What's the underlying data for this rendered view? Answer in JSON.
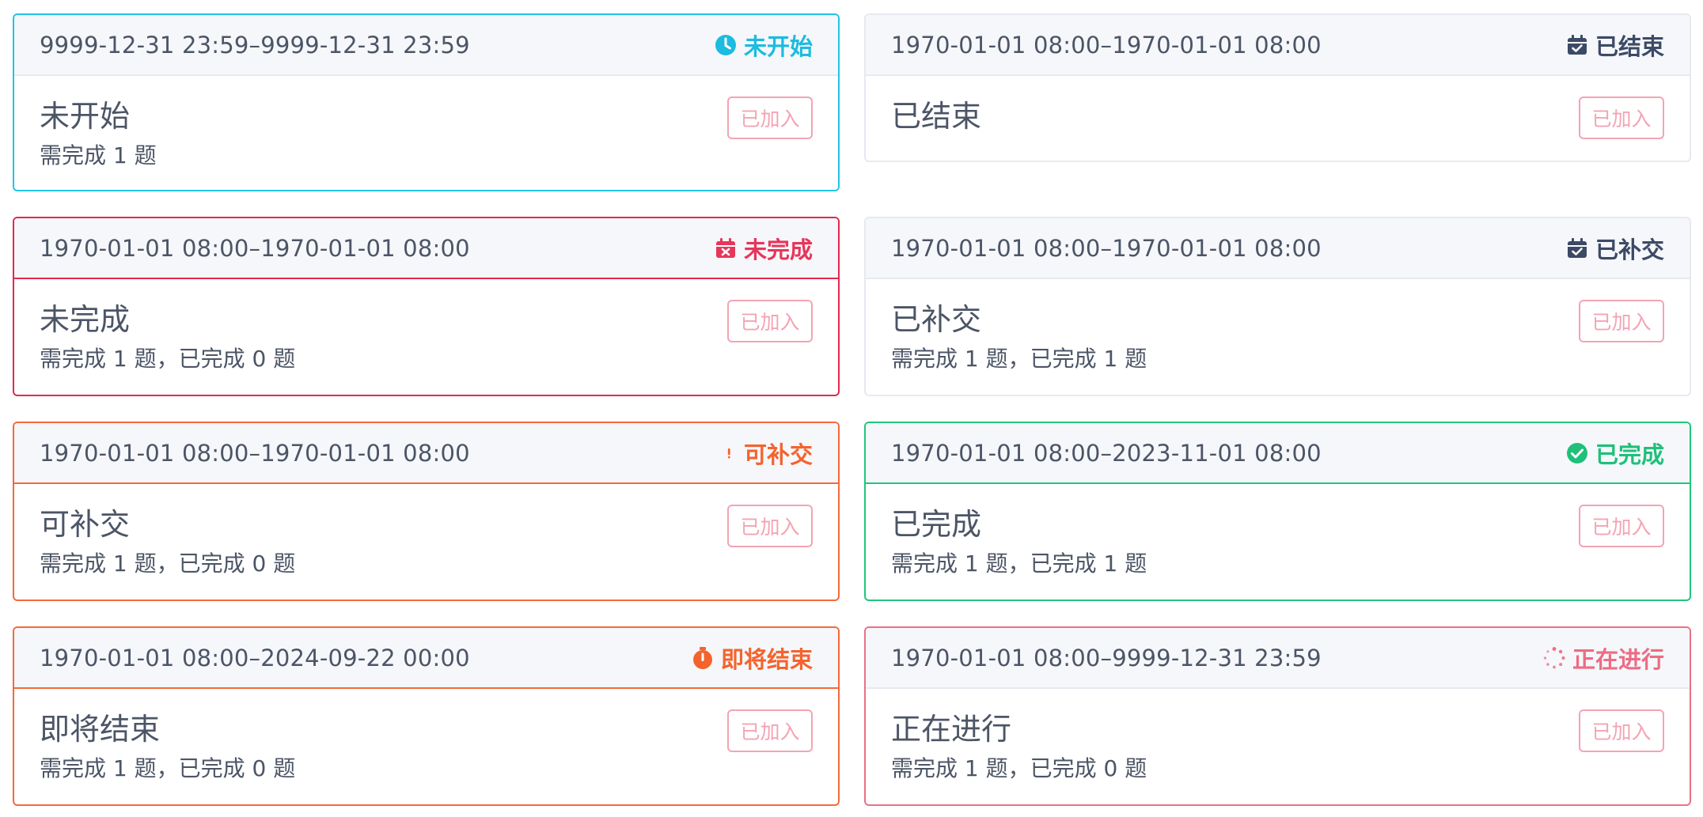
{
  "join_label": "已加入",
  "cards": [
    {
      "time": "9999-12-31 23:59–9999-12-31 23:59",
      "status": "未开始",
      "status_icon": "clock-icon",
      "title": "未开始",
      "desc": "需完成 1 题",
      "accent": "#1cbbe0"
    },
    {
      "time": "1970-01-01 08:00–1970-01-01 08:00",
      "status": "已结束",
      "status_icon": "calendar-check-icon",
      "title": "已结束",
      "desc": "",
      "accent": "#3c4a66"
    },
    {
      "time": "1970-01-01 08:00–1970-01-01 08:00",
      "status": "未完成",
      "status_icon": "calendar-x-icon",
      "title": "未完成",
      "desc": "需完成 1 题，已完成 0 题",
      "accent": "#e8355a"
    },
    {
      "time": "1970-01-01 08:00–1970-01-01 08:00",
      "status": "已补交",
      "status_icon": "calendar-check-icon",
      "title": "已补交",
      "desc": "需完成 1 题，已完成 1 题",
      "accent": "#3c4a66"
    },
    {
      "time": "1970-01-01 08:00–1970-01-01 08:00",
      "status": "可补交",
      "status_icon": "exclamation-icon",
      "title": "可补交",
      "desc": "需完成 1 题，已完成 0 题",
      "accent": "#f5632d"
    },
    {
      "time": "1970-01-01 08:00–2023-11-01 08:00",
      "status": "已完成",
      "status_icon": "check-circle-icon",
      "title": "已完成",
      "desc": "需完成 1 题，已完成 1 题",
      "accent": "#1fc07a"
    },
    {
      "time": "1970-01-01 08:00–2024-09-22 00:00",
      "status": "即将结束",
      "status_icon": "stopwatch-icon",
      "title": "即将结束",
      "desc": "需完成 1 题，已完成 0 题",
      "accent": "#f5632d"
    },
    {
      "time": "1970-01-01 08:00–9999-12-31 23:59",
      "status": "正在进行",
      "status_icon": "spinner-icon",
      "title": "正在进行",
      "desc": "需完成 1 题，已完成 0 题",
      "accent": "#ec6c84"
    }
  ]
}
